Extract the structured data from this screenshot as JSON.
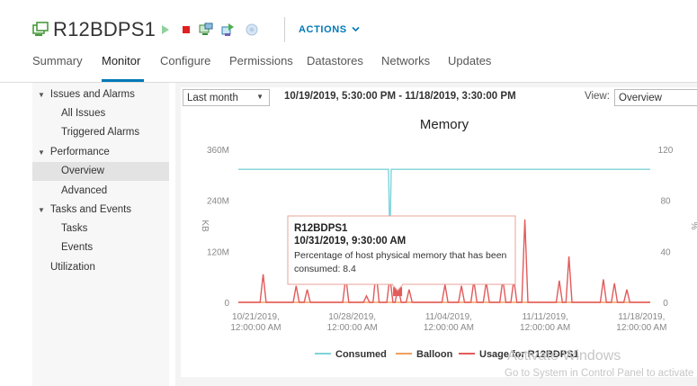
{
  "header": {
    "vm_name": "R12BDPS1",
    "actions_label": "ACTIONS",
    "toolbar_icons": [
      "vm-icon",
      "power-on-icon",
      "power-off-icon",
      "console-icon",
      "migrate-icon",
      "snapshot-icon"
    ]
  },
  "tabs": [
    {
      "label": "Summary",
      "active": false
    },
    {
      "label": "Monitor",
      "active": true
    },
    {
      "label": "Configure",
      "active": false
    },
    {
      "label": "Permissions",
      "active": false
    },
    {
      "label": "Datastores",
      "active": false
    },
    {
      "label": "Networks",
      "active": false
    },
    {
      "label": "Updates",
      "active": false
    }
  ],
  "sidebar": {
    "issues": {
      "label": "Issues and Alarms",
      "items": [
        "All Issues",
        "Triggered Alarms"
      ]
    },
    "performance": {
      "label": "Performance",
      "items": [
        "Overview",
        "Advanced"
      ]
    },
    "tasks": {
      "label": "Tasks and Events",
      "items": [
        "Tasks",
        "Events"
      ]
    },
    "utilization": "Utilization",
    "selected": "Overview"
  },
  "controls": {
    "period": "Last month",
    "date_range": "10/19/2019, 5:30:00 PM - 11/18/2019, 3:30:00 PM",
    "view_label": "View:",
    "view_value": "Overview"
  },
  "colors": {
    "accent": "#0079b8",
    "consumed": "#7fd3d9",
    "balloon": "#f0a060",
    "usage": "#e35a5a"
  },
  "chart_data": {
    "type": "line",
    "title": "Memory",
    "ylabel": "KB",
    "y2label": "%",
    "y_ticks": [
      "360M",
      "240M",
      "120M",
      "0"
    ],
    "y2_ticks": [
      "120",
      "80",
      "40",
      "0"
    ],
    "ylim": [
      0,
      360
    ],
    "y2lim": [
      0,
      120
    ],
    "x_ticks": [
      {
        "date": "10/21/2019,",
        "time": "12:00:00 AM"
      },
      {
        "date": "10/28/2019,",
        "time": "12:00:00 AM"
      },
      {
        "date": "11/04/2019,",
        "time": "12:00:00 AM"
      },
      {
        "date": "11/11/2019,",
        "time": "12:00:00 AM"
      },
      {
        "date": "11/18/2019,",
        "time": "12:00:00 AM"
      }
    ],
    "x_tick_days": [
      1.27,
      8.27,
      15.27,
      22.27,
      29.27
    ],
    "xlim_days": [
      0,
      29.9
    ],
    "series": [
      {
        "name": "Consumed",
        "axis": "left",
        "color": "#7fd3d9",
        "points": [
          [
            0,
            313
          ],
          [
            10.9,
            313
          ],
          [
            11.0,
            135
          ],
          [
            11.1,
            313
          ],
          [
            29.9,
            313
          ]
        ]
      },
      {
        "name": "Balloon",
        "axis": "left",
        "color": "#f0a060",
        "points": [
          [
            0,
            0
          ],
          [
            29.9,
            0
          ]
        ]
      },
      {
        "name": "Usage for R12BDPS1",
        "axis": "right",
        "color": "#e35a5a",
        "peaks": [
          [
            1.8,
            22
          ],
          [
            4.2,
            13
          ],
          [
            5.0,
            10
          ],
          [
            7.8,
            20
          ],
          [
            9.3,
            5
          ],
          [
            10.0,
            25
          ],
          [
            11.0,
            20
          ],
          [
            11.6,
            12
          ],
          [
            12.4,
            10
          ],
          [
            15.0,
            14
          ],
          [
            16.2,
            13
          ],
          [
            17.1,
            17
          ],
          [
            18.0,
            16
          ],
          [
            19.2,
            18
          ],
          [
            20.0,
            18
          ],
          [
            20.8,
            65
          ],
          [
            23.3,
            17
          ],
          [
            24.0,
            36
          ],
          [
            26.5,
            18
          ],
          [
            27.3,
            15
          ],
          [
            28.2,
            10
          ]
        ]
      }
    ],
    "tooltip": {
      "title": "R12BDPS1",
      "datetime": "10/31/2019, 9:30:00 AM",
      "description": "Percentage of host physical memory that has been",
      "value_line": "consumed: 8.4",
      "point": [
        11.56,
        8.4
      ]
    }
  },
  "watermark": {
    "line1": "Activate Windows",
    "line2": "Go to System in Control Panel to activate"
  }
}
